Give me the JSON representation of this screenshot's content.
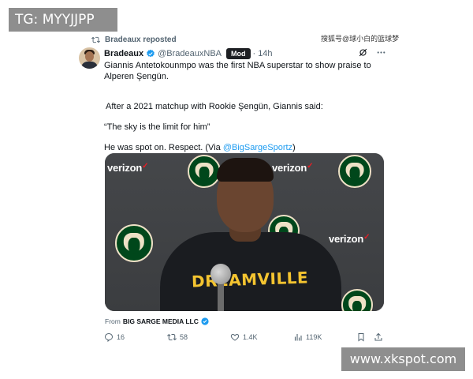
{
  "watermarks": {
    "top_left": "TG: MYYJJPP",
    "bottom_right": "www.xkspot.com",
    "top_right": "搜狐号@球小白的篮球梦"
  },
  "repost": {
    "label": "Bradeaux reposted",
    "icon": "repost-icon"
  },
  "tweet": {
    "author_name": "Bradeaux",
    "handle": "@BradeauxNBA",
    "badge": "Mod",
    "separator": "·",
    "time": "14h",
    "lines": {
      "l1": "Giannis Antetokounmpo was the first NBA superstar to show praise to Alperen Şengün.",
      "l2": "After a 2021 matchup with Rookie Şengün, Giannis said:",
      "l3": "“The sky is the limit for him”",
      "l4_prefix": "He was spot on. Respect. (Via ",
      "l4_link": "@BigSargeSportz",
      "l4_suffix": ")"
    }
  },
  "media": {
    "sponsor": "verizon",
    "sponsor_mark": "✓",
    "shirt_text": "DREAMVILLE"
  },
  "source": {
    "prefix": "From",
    "name": "BIG SARGE MEDIA LLC"
  },
  "actions": {
    "replies": "16",
    "reposts": "58",
    "likes": "1.4K",
    "views": "119K"
  },
  "colors": {
    "accent": "#1d9bf0",
    "bucks_green": "#00471b",
    "bucks_cream": "#eee1c6",
    "verizon_red": "#e81e25"
  }
}
